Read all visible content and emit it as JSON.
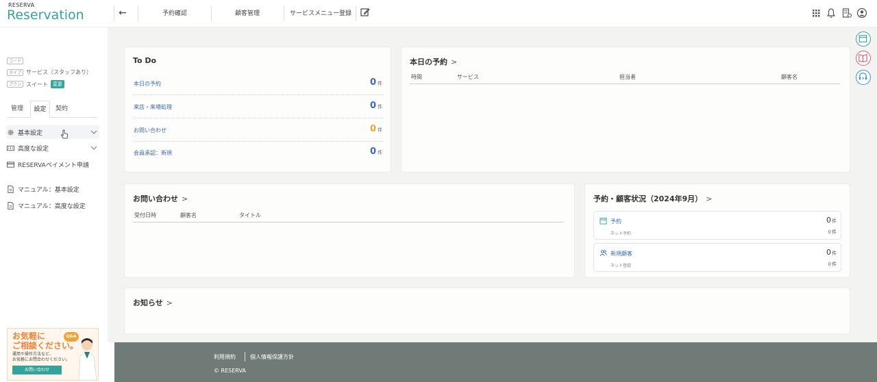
{
  "header": {
    "logo_small": "RESERVA",
    "logo_big": "Reservation",
    "nav": [
      "予約確認",
      "顧客管理",
      "サービスメニュー登録"
    ]
  },
  "sidebar": {
    "meta": [
      {
        "tag": "コード",
        "value": ""
      },
      {
        "tag": "タイプ",
        "value": "サービス（スタッフあり）"
      },
      {
        "tag": "プラン",
        "value": "スイート",
        "button": "変更"
      }
    ],
    "tabs": [
      "管理",
      "設定",
      "契約"
    ],
    "active_tab": "設定",
    "items": [
      {
        "label": "基本設定",
        "icon": "gear-icon"
      },
      {
        "label": "高度な設定",
        "icon": "advanced-settings-icon"
      },
      {
        "label": "RESERVAペイメント申請",
        "icon": "payment-card-icon"
      }
    ],
    "manuals": [
      "マニュアル：基本設定",
      "マニュアル：高度な設定"
    ],
    "banner": {
      "title": "お気軽に\nご相談ください。",
      "sub": "運用や操作方法など、\nお気軽にお問合わせください。",
      "button": "お問い合わせ",
      "badge": "Q&A"
    }
  },
  "todo": {
    "title": "To Do",
    "rows": [
      {
        "label": "本日の予約",
        "value": "0",
        "unit": "件",
        "color": "#3e6aa8"
      },
      {
        "label": "来店・来場処理",
        "value": "0",
        "unit": "件",
        "color": "#3e6aa8"
      },
      {
        "label": "お問い合わせ",
        "value": "0",
        "unit": "件",
        "color": "#f1a33b"
      },
      {
        "label": "会員承認：新規",
        "value": "0",
        "unit": "件",
        "color": "#3e6aa8"
      }
    ]
  },
  "today": {
    "title": "本日の予約",
    "columns": [
      "時間",
      "サービス",
      "担当者",
      "顧客名"
    ]
  },
  "inquiry": {
    "title": "お問い合わせ",
    "columns": [
      "受付日時",
      "顧客名",
      "タイトル"
    ]
  },
  "status": {
    "title": "予約・顧客状況（2024年9月）",
    "rows": [
      {
        "label": "予約",
        "value": "0",
        "unit": "件",
        "sub_label": "ネット予約",
        "sub_value": "0",
        "sub_unit": "件"
      },
      {
        "label": "新規顧客",
        "value": "0",
        "unit": "件",
        "sub_label": "ネット登録",
        "sub_value": "0",
        "sub_unit": "件"
      }
    ]
  },
  "news": {
    "title": "お知らせ"
  },
  "footer": {
    "terms": "利用規約",
    "privacy": "個人情報保護方針",
    "copyright": "© RESERVA"
  },
  "colors": {
    "brand": "#34a399",
    "link": "#3e6aa8",
    "warning": "#f1a33b",
    "footer": "#707a77"
  }
}
